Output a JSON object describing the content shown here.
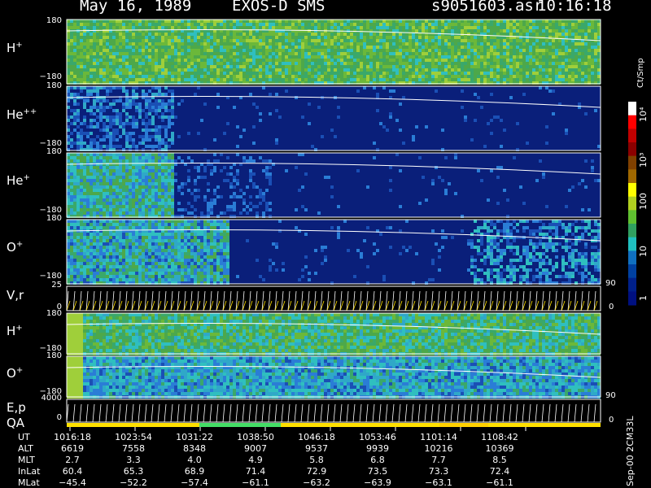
{
  "header": {
    "date": "May 16, 1989",
    "instrument": "EXOS-D SMS",
    "file": "s9051603.asr",
    "time": "10:16:18"
  },
  "colorbar": {
    "unit": "Ct/Smp",
    "labels": [
      "10⁴",
      "10³",
      "100",
      "10",
      "1"
    ]
  },
  "side_label": "Sep-00 2CM33L",
  "chart_data": {
    "type": "heatmap",
    "panels": [
      {
        "label": "H",
        "charge": "+",
        "ymax": "180",
        "ymin": "−180",
        "pattern": "broad"
      },
      {
        "label": "He",
        "charge": "++",
        "ymax": "180",
        "ymin": "−180",
        "pattern": "weak"
      },
      {
        "label": "He",
        "charge": "+",
        "ymax": "180",
        "ymin": "−180",
        "pattern": "early"
      },
      {
        "label": "O",
        "charge": "+",
        "ymax": "180",
        "ymin": "−180",
        "pattern": "edges"
      },
      {
        "label": "V,r",
        "charge": "",
        "ymax": "25",
        "ymin": "0",
        "rmax": "90",
        "rmin": "0",
        "pattern": "lines"
      },
      {
        "label": "H",
        "charge": "+",
        "ymax": "180",
        "ymin": "−180",
        "pattern": "dense"
      },
      {
        "label": "O",
        "charge": "+",
        "ymax": "180",
        "ymin": "−180",
        "pattern": "dense2"
      },
      {
        "label": "E,p",
        "charge": "",
        "ymax": "4000",
        "ymin": "0",
        "rmax": "90",
        "rmin": "0",
        "pattern": "lines",
        "label2": "QA"
      }
    ],
    "rows": [
      {
        "name": "UT",
        "values": [
          "1016:18",
          "1023:54",
          "1031:22",
          "1038:50",
          "1046:18",
          "1053:46",
          "1101:14",
          "1108:42"
        ]
      },
      {
        "name": "ALT",
        "values": [
          "6619",
          "7558",
          "8348",
          "9007",
          "9537",
          "9939",
          "10216",
          "10369"
        ]
      },
      {
        "name": "MLT",
        "values": [
          "2.7",
          "3.3",
          "4.0",
          "4.9",
          "5.8",
          "6.8",
          "7.7",
          "8.5"
        ]
      },
      {
        "name": "InLat",
        "values": [
          "60.4",
          "65.3",
          "68.9",
          "71.4",
          "72.9",
          "73.5",
          "73.3",
          "72.4"
        ]
      },
      {
        "name": "MLat",
        "values": [
          "−45.4",
          "−52.2",
          "−57.4",
          "−61.1",
          "−63.2",
          "−63.9",
          "−63.1",
          "−61.1"
        ]
      }
    ]
  }
}
